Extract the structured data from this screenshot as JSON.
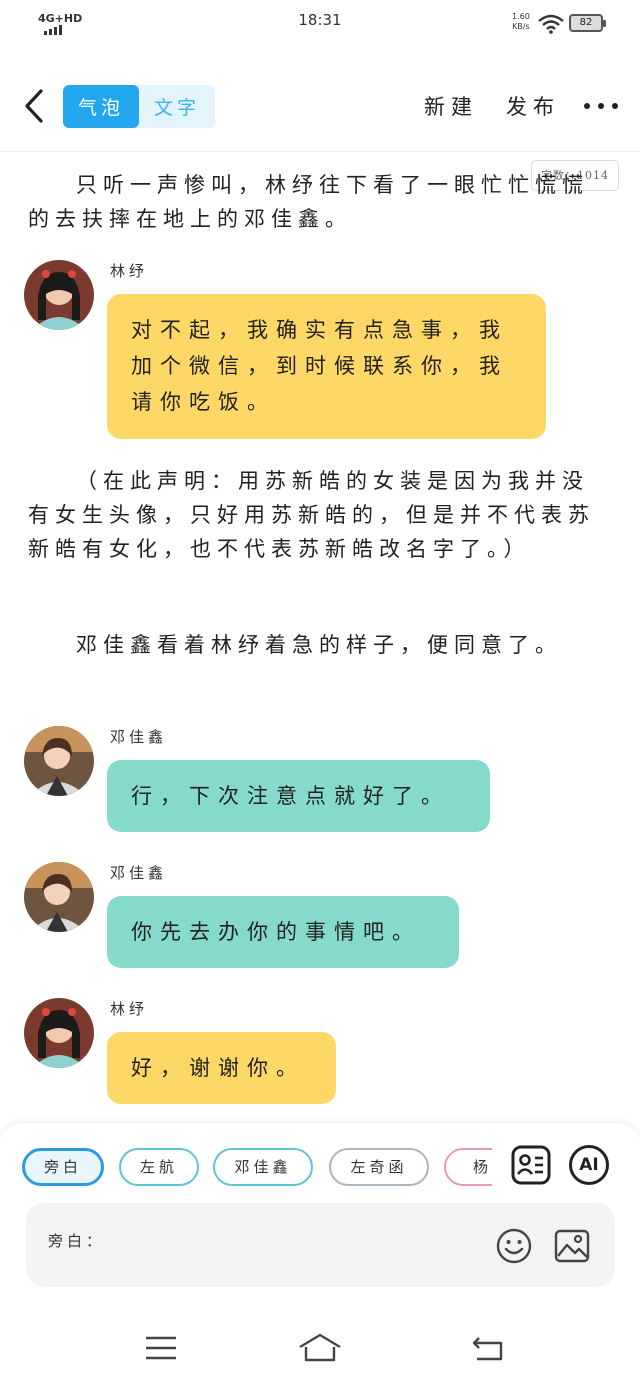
{
  "status_bar": {
    "network": "4G+HD",
    "time": "18:31",
    "speed_value": "1.60",
    "speed_unit": "KB/s",
    "battery": "82"
  },
  "toolbar": {
    "tab_bubble": "气泡",
    "tab_text": "文字",
    "new_label": "新建",
    "publish_label": "发布"
  },
  "content": {
    "word_count": "字数：1014",
    "narration_1": "只听一声惨叫，林纾往下看了一眼忙忙慌慌的去扶摔在地上的邓佳鑫。",
    "message_1": {
      "speaker": "林纾",
      "text": "对不起，我确实有点急事，我加个微信，到时候联系你，我请你吃饭。"
    },
    "narration_2": "（在此声明：用苏新皓的女装是因为我并没有女生头像，只好用苏新皓的，但是并不代表苏新皓有女化，也不代表苏新皓改名字了。）",
    "narration_3": "邓佳鑫看着林纾着急的样子，便同意了。",
    "message_2": {
      "speaker": "邓佳鑫",
      "text": "行，下次注意点就好了。"
    },
    "message_3": {
      "speaker": "邓佳鑫",
      "text": "你先去办你的事情吧。"
    },
    "message_4": {
      "speaker": "林纾",
      "text": "好，谢谢你。"
    }
  },
  "composer": {
    "chips": [
      {
        "label": "旁白",
        "color": "#2a9be0"
      },
      {
        "label": "左航",
        "color": "#5cc6d8"
      },
      {
        "label": "邓佳鑫",
        "color": "#5cc6d8"
      },
      {
        "label": "左奇函",
        "color": "#a9b6c4"
      },
      {
        "label": "杨博",
        "color": "#e99ab0"
      }
    ],
    "ai_label": "AI",
    "input_prefix": "旁白："
  },
  "colors": {
    "accent": "#22a7ef",
    "bubble_yellow": "#fdd866",
    "bubble_teal": "#86d9cd"
  }
}
